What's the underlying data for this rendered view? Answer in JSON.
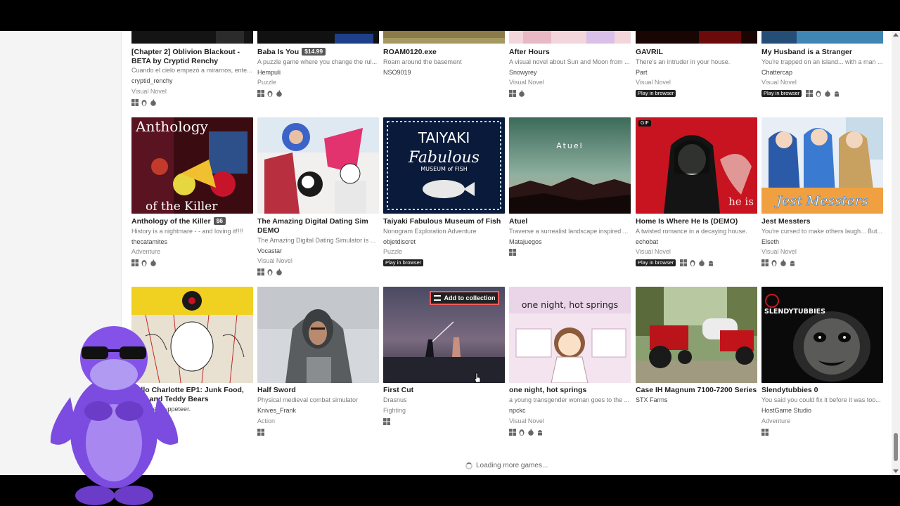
{
  "loading_text": "Loading more games...",
  "add_to_collection": "Add to collection",
  "gif_label": "GIF",
  "play_in_browser": "Play in browser",
  "row1": [
    {
      "title": "[Chapter 2] Oblivion Blackout - BETA by Cryptid Renchy",
      "desc": "Cuando el cielo empezó a mirarnos, ente...",
      "author": "cryptid_renchy",
      "genre": "Visual Novel",
      "platforms": [
        "windows-icon",
        "linux-icon",
        "apple-icon"
      ]
    },
    {
      "title": "Baba Is You",
      "price": "$14.99",
      "desc": "A puzzle game where you change the rul...",
      "author": "Hempuli",
      "genre": "Puzzle",
      "platforms": [
        "windows-icon",
        "linux-icon",
        "apple-icon"
      ]
    },
    {
      "title": "ROAM0120.exe",
      "desc": "Roam around the basement",
      "author": "NSO9019",
      "genre": "",
      "platforms": []
    },
    {
      "title": "After Hours",
      "desc": "A visual novel about Sun and Moon from ...",
      "author": "Snowyrey",
      "genre": "Visual Novel",
      "platforms": [
        "windows-icon",
        "apple-icon"
      ]
    },
    {
      "title": "GAVRIL",
      "desc": "There's an intruder in your house.",
      "author": "Part",
      "genre": "Visual Novel",
      "platforms": [],
      "browser": true
    },
    {
      "title": "My Husband is a Stranger",
      "desc": "You're trapped on an island... with a man ...",
      "author": "Chattercap",
      "genre": "Visual Novel",
      "platforms": [
        "windows-icon",
        "linux-icon",
        "apple-icon",
        "android-icon"
      ],
      "browser": true
    }
  ],
  "row2": [
    {
      "title": "Anthology of the Killer",
      "price": "$6",
      "desc": "History is a nightmare - - and loving it!!!!",
      "author": "thecatamites",
      "genre": "Adventure",
      "platforms": [
        "windows-icon",
        "linux-icon",
        "apple-icon"
      ]
    },
    {
      "title": "The Amazing Digital Dating Sim DEMO",
      "desc": "The Amazing Digital Dating Simulator is ...",
      "author": "Vocastar",
      "genre": "Visual Novel",
      "platforms": [
        "windows-icon",
        "linux-icon",
        "apple-icon"
      ]
    },
    {
      "title": "Taiyaki Fabulous Museum of Fish",
      "desc": "Nonogram Exploration Adventure",
      "author": "objetdiscret",
      "genre": "Puzzle",
      "platforms": [],
      "browser": true
    },
    {
      "title": "Atuel",
      "desc": "Traverse a surrealist landscape inspired ...",
      "author": "Matajuegos",
      "genre": "",
      "platforms": [
        "windows-icon"
      ]
    },
    {
      "title": "Home Is Where He Is (DEMO)",
      "desc": "A twisted romance in a decaying house.",
      "author": "echobat",
      "genre": "Visual Novel",
      "platforms": [
        "windows-icon",
        "linux-icon",
        "apple-icon",
        "android-icon"
      ],
      "browser": true
    },
    {
      "title": "Jest Messters",
      "desc": "You're cursed to make others laugh... But...",
      "author": "Elseth",
      "genre": "Visual Novel",
      "platforms": [
        "windows-icon",
        "linux-icon",
        "apple-icon",
        "android-icon"
      ]
    }
  ],
  "row3": [
    {
      "title": "Hello Charlotte EP1: Junk Food, Bats and Teddy Bears",
      "desc": "",
      "author": "etherane, Puppeteer.",
      "genre": "",
      "platforms": []
    },
    {
      "title": "Half Sword",
      "desc": "Physical medieval combat simulator",
      "author": "Knives_Frank",
      "genre": "Action",
      "platforms": [
        "windows-icon"
      ]
    },
    {
      "title": "First Cut",
      "desc": "Drasnus",
      "author": "Fighting",
      "genre": "",
      "platforms": [
        "windows-icon"
      ]
    },
    {
      "title": "one night, hot springs",
      "desc": "a young transgender woman goes to the ...",
      "author": "npckc",
      "genre": "Visual Novel",
      "platforms": [
        "windows-icon",
        "linux-icon",
        "apple-icon",
        "android-icon"
      ]
    },
    {
      "title": "Case IH Magnum 7100-7200 Series",
      "desc": "STX Farms",
      "author": "",
      "genre": "",
      "platforms": []
    },
    {
      "title": "Slendytubbies 0",
      "desc": "You said you could fix it before it was too...",
      "author": "HostGame Studio",
      "genre": "Adventure",
      "platforms": [
        "windows-icon"
      ]
    }
  ],
  "thumb_text": {
    "anthology_a": "Anthology",
    "anthology_b": "of the Killer",
    "taiyaki_a": "TAIYAKI",
    "taiyaki_b": "Fabulous",
    "taiyaki_c": "MUSEUM of FISH",
    "atuel": "Atuel",
    "home_is": "he is",
    "jest": "Jest Messters",
    "hot_springs": "one night, hot springs",
    "slendy": "SLENDYTUBBIES"
  },
  "colors": {
    "accent": "#fa5c5c",
    "page_bg": "#ffffff",
    "sidebar_bg": "#f4f4f4"
  }
}
